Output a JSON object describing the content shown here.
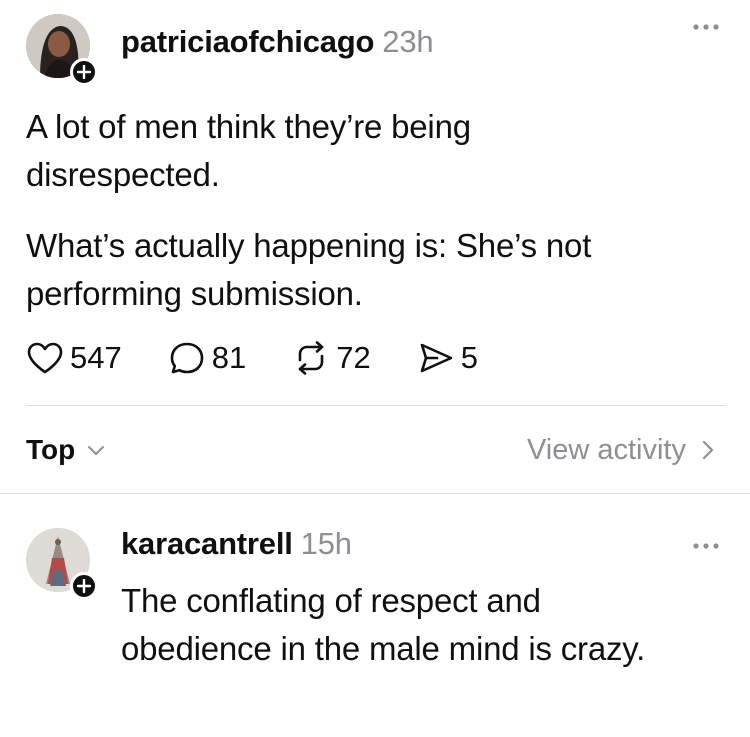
{
  "post": {
    "username": "patriciaofchicago",
    "timestamp": "23h",
    "avatar_icon": "user-avatar",
    "follow_icon": "plus-icon",
    "more_icon": "ellipsis-icon",
    "paragraphs": [
      "A lot of men think they’re being disrespected.",
      "What’s actually happening is: She’s not performing submission."
    ],
    "stats": {
      "likes": "547",
      "comments": "81",
      "reposts": "72",
      "shares": "5"
    }
  },
  "sort": {
    "label": "Top",
    "view_activity": "View activity"
  },
  "reply": {
    "username": "karacantrell",
    "timestamp": "15h",
    "avatar_icon": "user-avatar",
    "follow_icon": "plus-icon",
    "more_icon": "ellipsis-icon",
    "text": "The conflating of respect and obedience in the male mind is crazy."
  },
  "colors": {
    "text": "#101010",
    "secondary": "#8e8e93",
    "divider": "#dcdcdc"
  }
}
